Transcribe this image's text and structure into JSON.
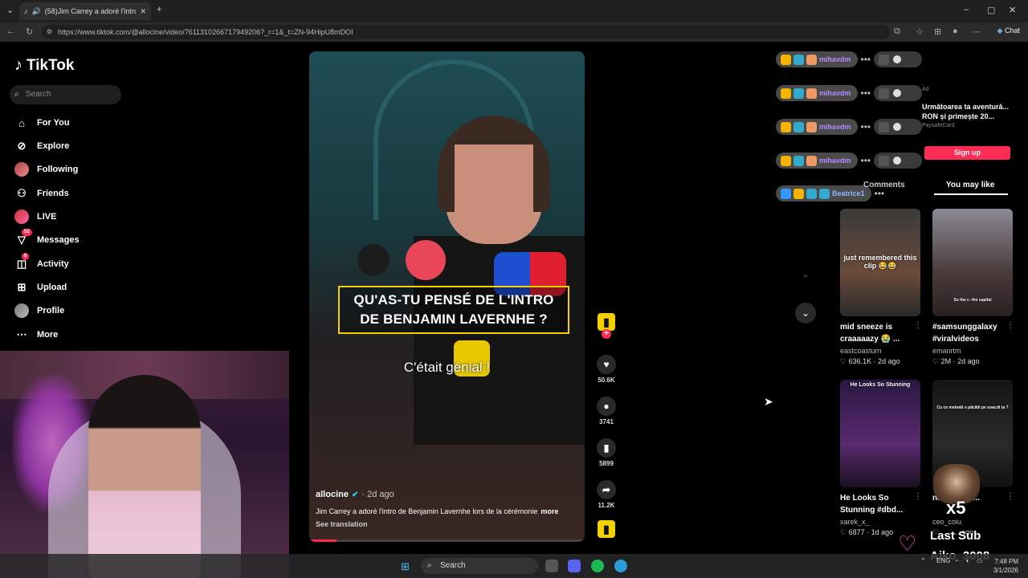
{
  "browser": {
    "tab_title": "(58)Jim Carrey a adoré l'intro",
    "url": "https://www.tiktok.com/@allocine/video/7611310266717949206?_r=1&_t=ZN-94HipU8mDOI",
    "chat_label": "Chat"
  },
  "sidebar": {
    "logo": "TikTok",
    "search_placeholder": "Search",
    "items": [
      {
        "label": "For You",
        "icon": "home-icon"
      },
      {
        "label": "Explore",
        "icon": "compass-icon"
      },
      {
        "label": "Following",
        "icon": "avatar"
      },
      {
        "label": "Friends",
        "icon": "friends-icon"
      },
      {
        "label": "LIVE",
        "icon": "avatar"
      },
      {
        "label": "Messages",
        "icon": "message-icon",
        "badge": "52"
      },
      {
        "label": "Activity",
        "icon": "bell-icon",
        "badge": "6"
      },
      {
        "label": "Upload",
        "icon": "plus-box-icon"
      },
      {
        "label": "Profile",
        "icon": "avatar"
      },
      {
        "label": "More",
        "icon": "more-icon"
      }
    ]
  },
  "video": {
    "caption_line1": "QU'AS-TU PENSÉ DE L'INTRO",
    "caption_line2": "DE BENJAMIN LAVERNHE ?",
    "subtitle": "C'était génial !",
    "author": "allocine",
    "age": "· 2d ago",
    "description": "Jim Carrey a adoré l'intro de Benjamin Lavernhe lors de la cérémonie",
    "more": "more",
    "see_translation": "See translation",
    "progress": 0.1
  },
  "actions": {
    "likes": "50.6K",
    "comments": "3741",
    "saves": "5899",
    "shares": "11.2K"
  },
  "chat_overlay": [
    {
      "name": "mihavdm"
    },
    {
      "name": "mihavdm"
    },
    {
      "name": "mihavdm"
    },
    {
      "name": "mihavdm"
    },
    {
      "name": "Beatrice1"
    }
  ],
  "ad": {
    "label": "Ad",
    "title": "Următoarea ta aventură... RON și primește 20...",
    "sponsor": "PaysafeCard",
    "signup": "Sign up"
  },
  "right_panel": {
    "tab_comments": "Comments",
    "tab_you_may_like": "You may like",
    "cards": [
      {
        "overlay": "just remembered this clip 😂😂",
        "title": "mid sneeze is craaaaazy 😭 ...",
        "author": "eastcoasturn",
        "stats": "♡ 636.1K · 2d ago"
      },
      {
        "overlay": "So the c- the capital",
        "title": "#samsunggalaxy #viralvideos",
        "author": "emanrtm",
        "stats": "♡ 2M · 2d ago"
      },
      {
        "overlay": "He Looks So Stunning",
        "title": "He Looks So Stunning #dbd...",
        "author": "xarek_x_",
        "stats": "♡ 6877 · 1d ago"
      },
      {
        "overlay": "Cu ce metodă o păcălii pe soacră ta ?",
        "title": "n... tru soa...",
        "author": "ceo_coiu",
        "stats": "♡ ... · ... ago"
      }
    ]
  },
  "stream": {
    "last_sub_label": "Last Sub",
    "last_sub_name": "Aiko_3008",
    "multiplier": "x5"
  },
  "taskbar": {
    "search": "Search",
    "lang": "ENG",
    "time": "7:48 PM",
    "date": "3/1/2026"
  }
}
